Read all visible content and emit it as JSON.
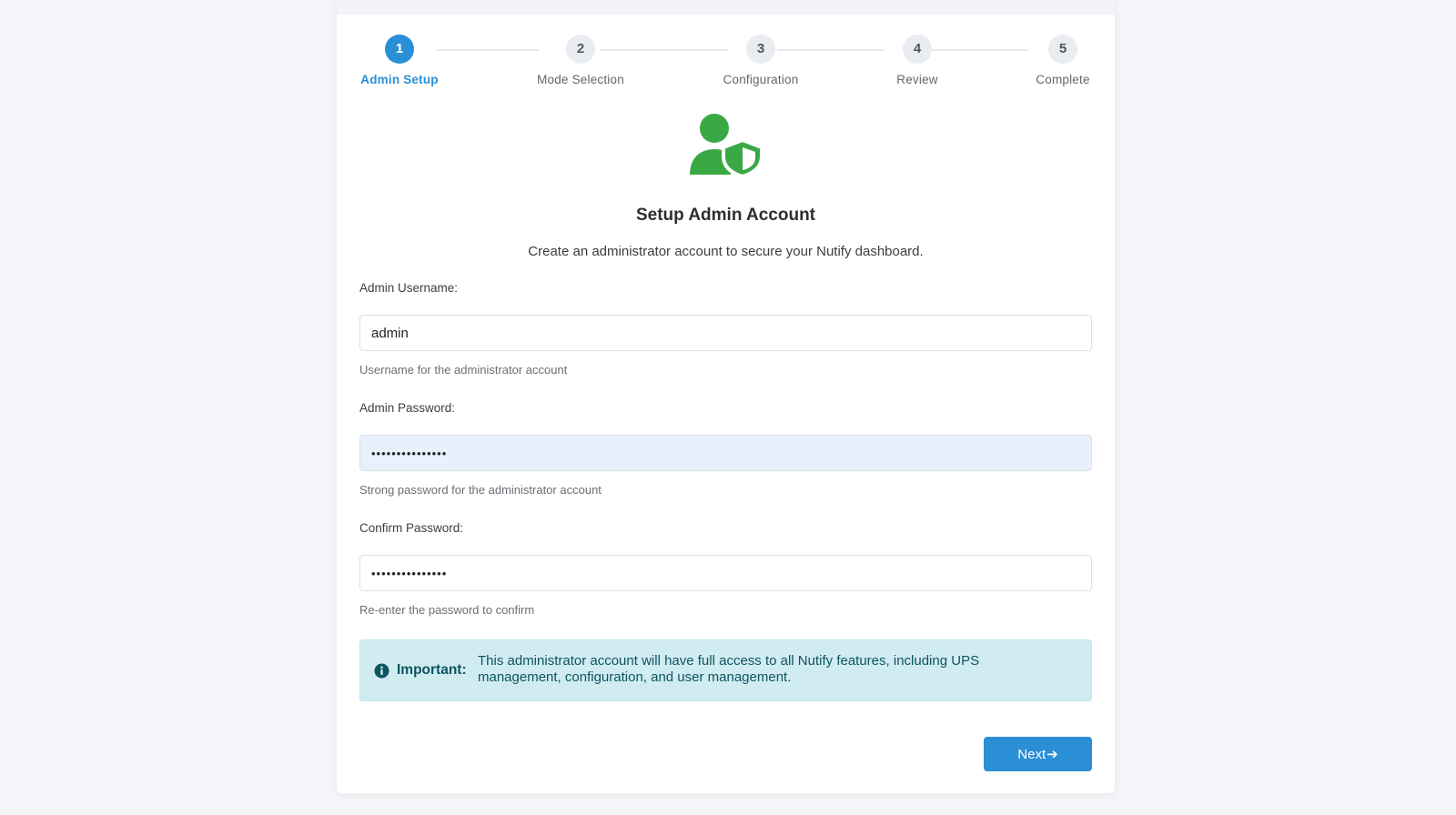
{
  "stepper": {
    "steps": [
      {
        "number": "1",
        "label": "Admin Setup",
        "active": true
      },
      {
        "number": "2",
        "label": "Mode Selection",
        "active": false
      },
      {
        "number": "3",
        "label": "Configuration",
        "active": false
      },
      {
        "number": "4",
        "label": "Review",
        "active": false
      },
      {
        "number": "5",
        "label": "Complete",
        "active": false
      }
    ]
  },
  "header": {
    "icon": "user-shield-icon",
    "title": "Setup Admin Account",
    "subtitle": "Create an administrator account to secure your Nutify dashboard."
  },
  "form": {
    "username": {
      "label": "Admin Username:",
      "value": "admin",
      "hint": "Username for the administrator account"
    },
    "password": {
      "label": "Admin Password:",
      "value": "•••••••••••••••",
      "hint": "Strong password for the administrator account"
    },
    "confirm": {
      "label": "Confirm Password:",
      "value": "•••••••••••••••",
      "hint": "Re-enter the password to confirm"
    }
  },
  "alert": {
    "icon": "info-circle-icon",
    "strong": "Important:",
    "text": "This administrator account will have full access to all Nutify features, including UPS management, configuration, and user management."
  },
  "actions": {
    "next_label": "Next",
    "next_icon": "arrow-right-icon"
  },
  "colors": {
    "accent": "#2b8fd6",
    "icon_green": "#3aa845",
    "alert_bg": "#d1ecf1",
    "alert_text": "#0c5460"
  }
}
